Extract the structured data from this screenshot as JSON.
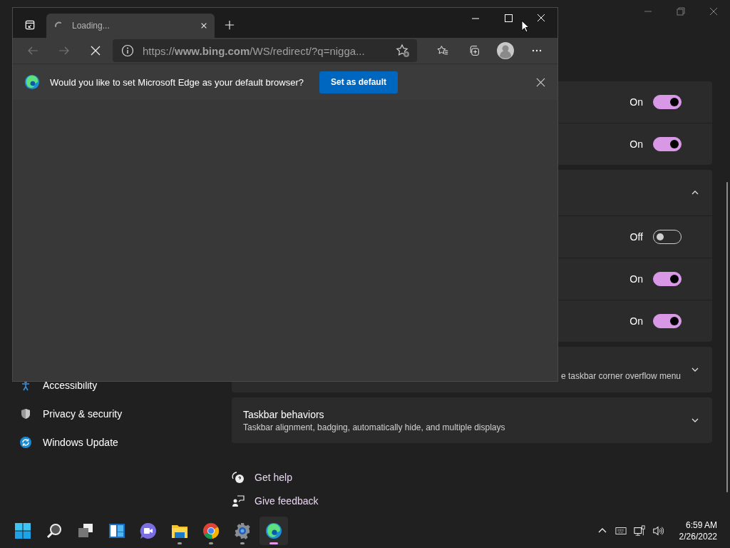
{
  "settings_window": {
    "sidebar": {
      "items": [
        {
          "label": "Accessibility"
        },
        {
          "label": "Privacy & security"
        },
        {
          "label": "Windows Update"
        }
      ]
    },
    "groups": [
      {
        "kind": "list",
        "rows": [
          {
            "kind": "toggle",
            "state_label": "On",
            "on": true
          },
          {
            "kind": "toggle",
            "state_label": "On",
            "on": true
          }
        ]
      },
      {
        "kind": "expander",
        "expanded": true,
        "rows": [
          {
            "kind": "toggle",
            "state_label": "Off",
            "on": false
          },
          {
            "kind": "toggle",
            "state_label": "On",
            "on": true
          },
          {
            "kind": "toggle",
            "state_label": "On",
            "on": true
          }
        ]
      },
      {
        "kind": "expander",
        "expanded": false,
        "description": "e taskbar corner overflow menu"
      },
      {
        "kind": "expander",
        "expanded": false,
        "title": "Taskbar behaviors",
        "description": "Taskbar alignment, badging, automatically hide, and multiple displays"
      }
    ],
    "links": [
      {
        "label": "Get help"
      },
      {
        "label": "Give feedback"
      }
    ]
  },
  "browser": {
    "tab": {
      "title": "Loading...",
      "loading": true
    },
    "url": "https://**www.bing.com**/WS/redirect/?q=nigga...",
    "infobar": {
      "message": "Would you like to set Microsoft Edge as your default browser?",
      "button": "Set as default"
    }
  },
  "taskbar": {
    "apps": [
      {
        "running": false,
        "selected": false
      },
      {
        "running": false,
        "selected": false
      },
      {
        "running": false,
        "selected": false
      },
      {
        "running": false,
        "selected": false
      },
      {
        "running": false,
        "selected": false
      },
      {
        "running": true,
        "selected": false
      },
      {
        "running": true,
        "selected": false
      },
      {
        "running": true,
        "selected": false
      },
      {
        "running": true,
        "selected": true
      }
    ],
    "clock": {
      "time": "6:59 AM",
      "date": "2/26/2022"
    }
  }
}
